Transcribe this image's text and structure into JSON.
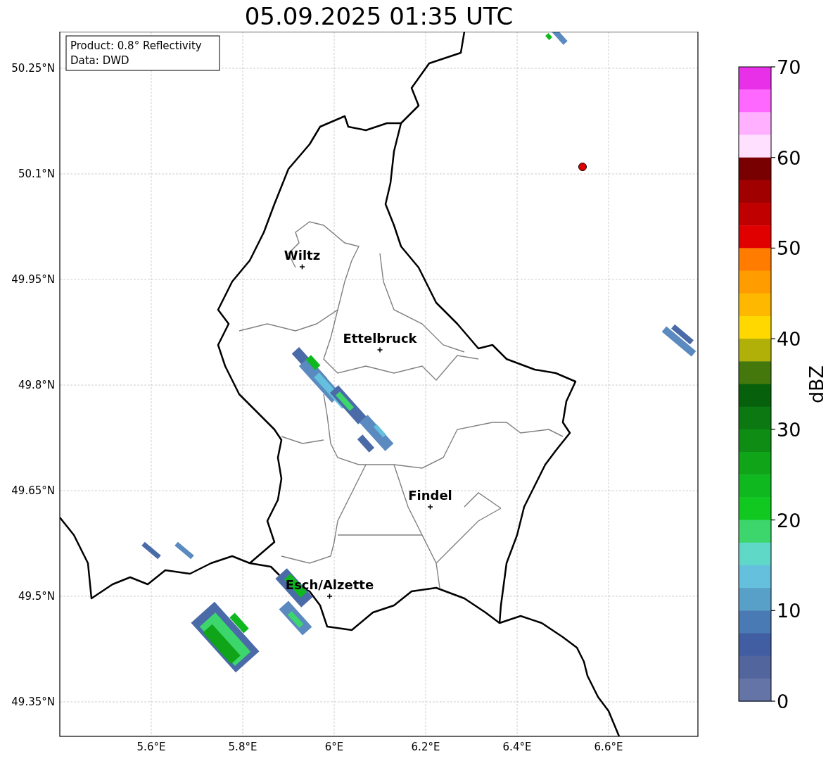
{
  "title": "05.09.2025 01:35 UTC",
  "info_box": [
    "Product: 0.8° Reflectivity",
    "Data: DWD"
  ],
  "map": {
    "xticks": [
      "5.6°E",
      "5.8°E",
      "6°E",
      "6.2°E",
      "6.4°E",
      "6.6°E"
    ],
    "yticks": [
      "50.25°N",
      "50.1°N",
      "49.95°N",
      "49.8°N",
      "49.65°N",
      "49.5°N",
      "49.35°N"
    ],
    "cities": [
      "Wiltz",
      "Ettelbruck",
      "Findel",
      "Esch/Alzette"
    ]
  },
  "colorbar": {
    "label": "dBZ",
    "ticks": [
      "70",
      "60",
      "50",
      "40",
      "30",
      "20",
      "10",
      "0"
    ],
    "colors": [
      {
        "color": "#e830e8"
      },
      {
        "color": "#ff68ff"
      },
      {
        "color": "#ffb0ff"
      },
      {
        "color": "#ffe0ff"
      },
      {
        "color": "#780000"
      },
      {
        "color": "#a00000"
      },
      {
        "color": "#c00000"
      },
      {
        "color": "#e00000"
      },
      {
        "color": "#ff7c00"
      },
      {
        "color": "#ff9c00"
      },
      {
        "color": "#ffb800"
      },
      {
        "color": "#ffd800"
      },
      {
        "color": "#b0b008"
      },
      {
        "color": "#44780c"
      },
      {
        "color": "#06600c"
      },
      {
        "color": "#0b7812"
      },
      {
        "color": "#0e8c14"
      },
      {
        "color": "#10a418"
      },
      {
        "color": "#10b820"
      },
      {
        "color": "#10c820"
      },
      {
        "color": "#3cd66c"
      },
      {
        "color": "#60d8c8"
      },
      {
        "color": "#64c0dc"
      },
      {
        "color": "#58a0c8"
      },
      {
        "color": "#4a7ab4"
      },
      {
        "color": "#425ea2"
      },
      {
        "color": "#52659d"
      },
      {
        "color": "#6474a6"
      }
    ]
  }
}
